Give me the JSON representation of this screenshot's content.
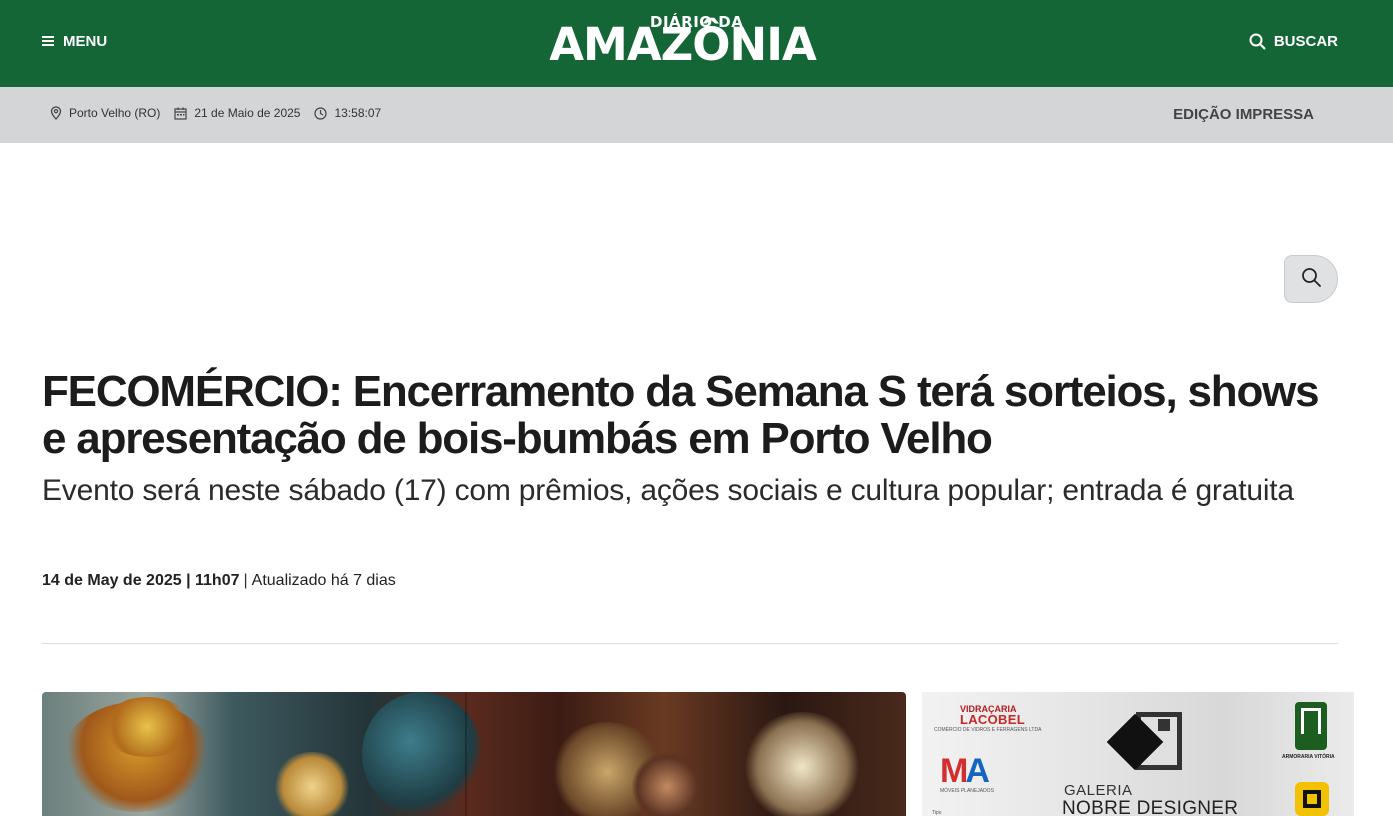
{
  "header": {
    "menu_label": "MENU",
    "logo_top": "DIÁRIO DA",
    "logo_main": "AMAZÔNIA",
    "search_label": "BUSCAR",
    "bg_color": "#156637"
  },
  "infobar": {
    "location": "Porto Velho (RO)",
    "date": "21 de Maio de 2025",
    "time": "13:58:07",
    "print_edition": "EDIÇÃO IMPRESSA",
    "bg_color": "#d4d5d7"
  },
  "article": {
    "title": "FECOMÉRCIO: Encerramento da Semana S terá sorteios, shows e apresentação de bois-bumbás em Porto Velho",
    "subtitle": "Evento será neste sábado (17) com prêmios, ações sociais e cultura popular; entrada é gratuita",
    "published": "14 de May de 2025 | 11h07",
    "separator": "|",
    "updated": "Atualizado há 7 dias"
  },
  "ad": {
    "vidracaria": "VIDRAÇARIA",
    "lacobel": "LACOBEL",
    "lacobel_sub": "COMÉRCIO DE VIDROS E FERRAGENS LTDA",
    "ma_logo_m": "M",
    "ma_logo_a": "A",
    "moveis": "MÓVEIS PLANEJADOS",
    "galeria": "GALERIA",
    "nobre": "NOBRE DESIGNER",
    "tipo": "Tipo",
    "armoraria": "ARMORARIA VITÓRIA"
  },
  "icons": {
    "menu": "hamburger-icon",
    "search": "search-icon",
    "location": "map-pin-icon",
    "date": "calendar-icon",
    "time": "clock-icon"
  }
}
